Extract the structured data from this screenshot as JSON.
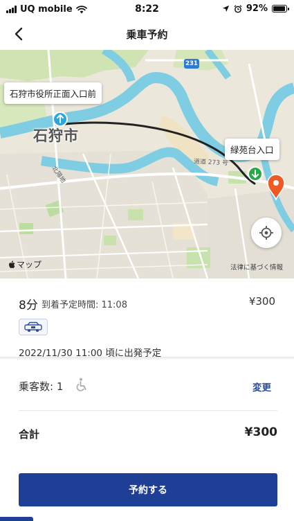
{
  "status_bar": {
    "carrier": "UQ mobile",
    "time": "8:22",
    "battery": "92%",
    "battery_level": 0.92
  },
  "header": {
    "title": "乗車予約"
  },
  "map": {
    "pickup_label": "石狩市役所正面入口前",
    "dropoff_label": "緑苑台入口",
    "city_label": "石狩市",
    "road_label": "道道 273 号",
    "district_label": "北陽地",
    "highway_shield": "231",
    "attribution": "マップ",
    "legal": "法律に基づく情報",
    "colors": {
      "route": "#222222",
      "pickup_pin": "#2aa7dd",
      "dropoff_pin": "#29a84a",
      "destination_pin": "#ef5a24",
      "river": "#74c9df"
    }
  },
  "trip": {
    "duration": "8分",
    "eta": "到着予定時間: 11:08",
    "fare": "¥300",
    "vehicle_icon": "taxi-icon",
    "departure": "2022/11/30 11:00 頃に出発予定"
  },
  "booking": {
    "passengers_label": "乗客数: 1",
    "accessibility_icon": "wheelchair-icon",
    "change_label": "変更",
    "total_label": "合計",
    "total_amount": "¥300",
    "cta_label": "予約する",
    "accent": "#1f3f97"
  }
}
